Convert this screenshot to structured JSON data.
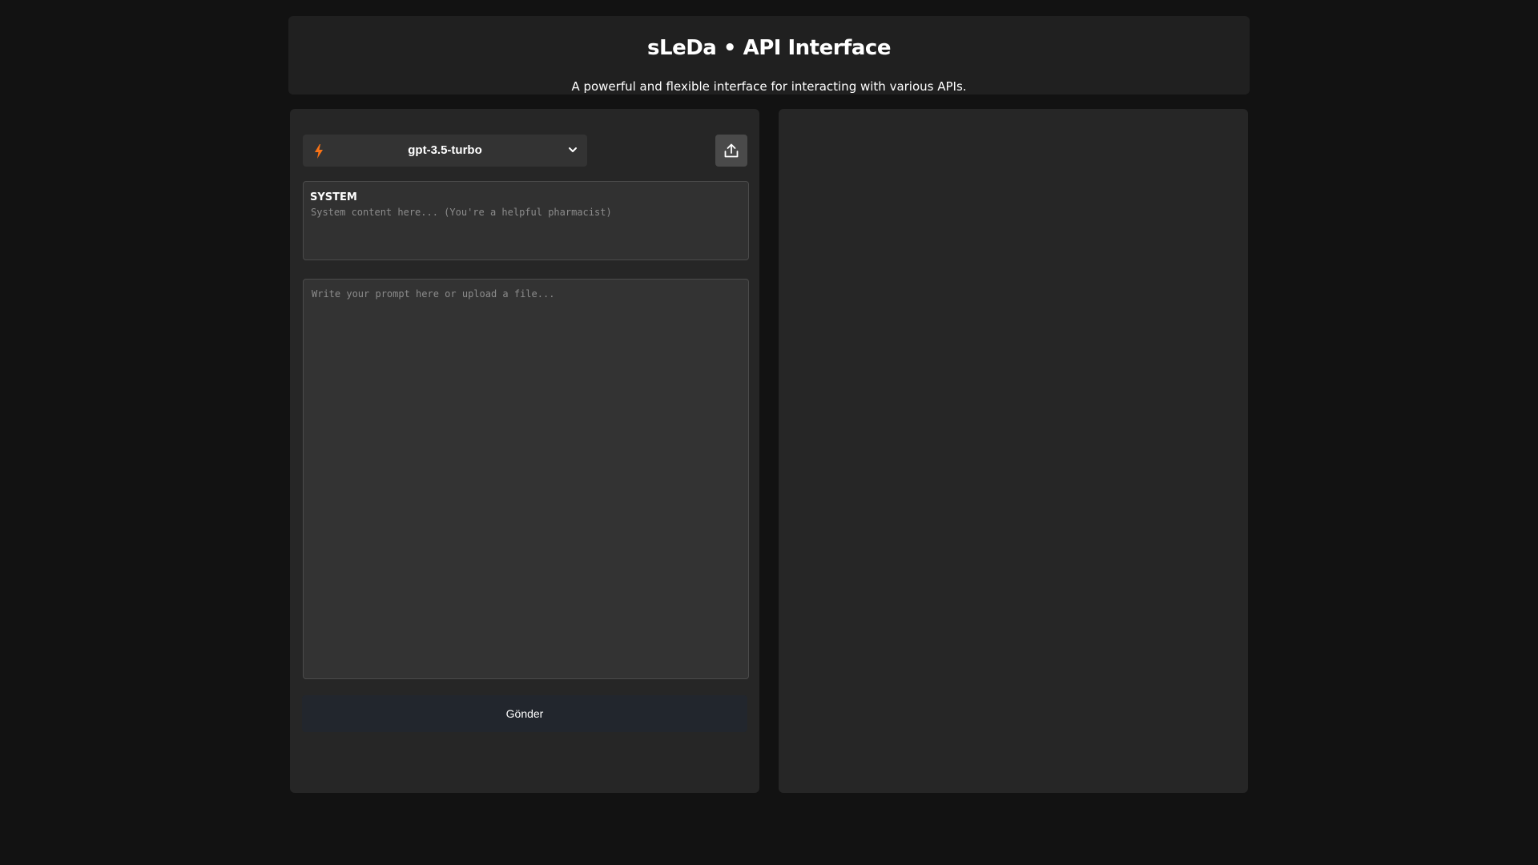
{
  "header": {
    "title": "sLeDa • API Interface",
    "subtitle": "A powerful and flexible interface for interacting with various APIs."
  },
  "model_select": {
    "selected": "gpt-3.5-turbo",
    "icon": "bolt-icon",
    "chevron_icon": "chevron-down-icon",
    "accent_color": "#f97316"
  },
  "upload": {
    "icon": "upload-icon"
  },
  "system": {
    "label": "SYSTEM",
    "value": "",
    "placeholder": "System content here... (You're a helpful pharmacist)"
  },
  "prompt": {
    "value": "",
    "placeholder": "Write your prompt here or upload a file..."
  },
  "send_button": {
    "label": "Gönder"
  },
  "colors": {
    "background": "#121212",
    "panel": "#262626",
    "input": "#333333",
    "button": "#22262d"
  }
}
